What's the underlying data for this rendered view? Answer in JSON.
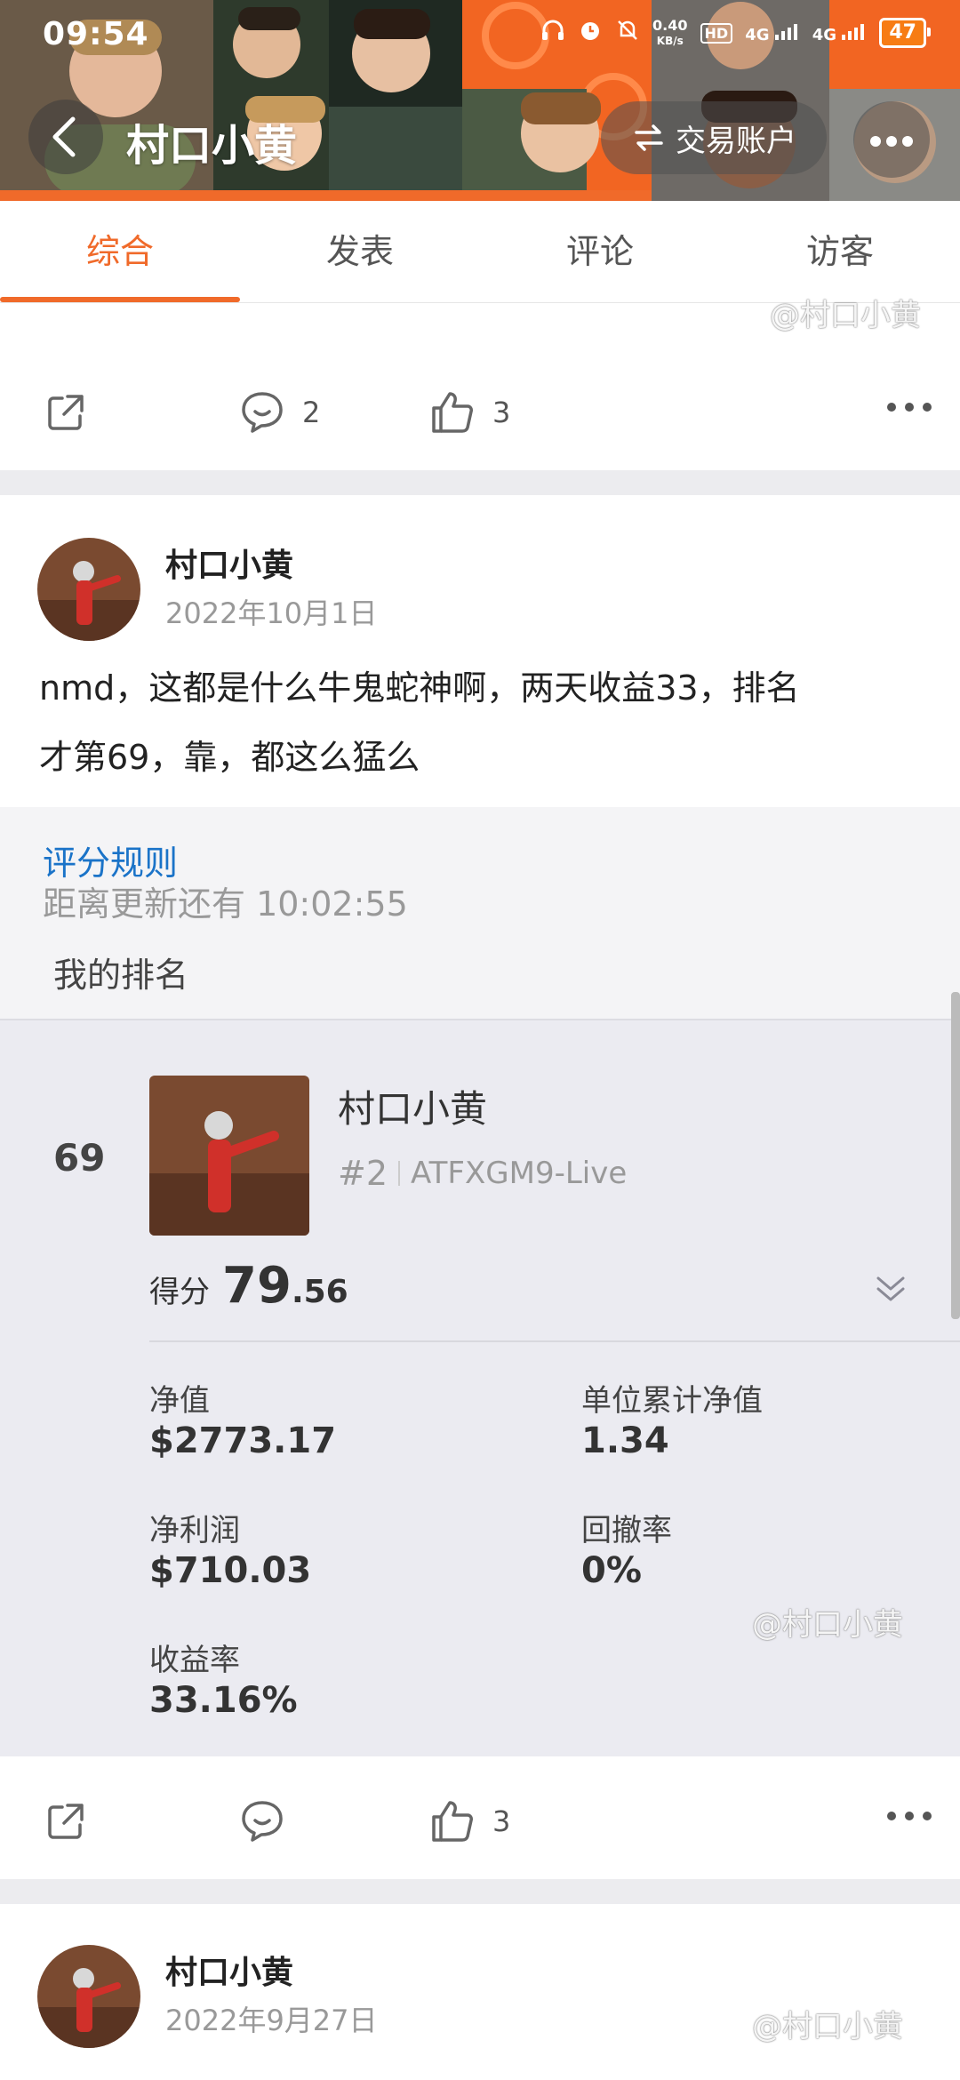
{
  "status_bar": {
    "time": "09:54",
    "net_speed_value": "0.40",
    "net_speed_unit": "KB/s",
    "hd_label": "HD",
    "sim1": "4G",
    "sim2": "4G",
    "battery": "47"
  },
  "header": {
    "title": "村口小黄",
    "account_button": "交易账户"
  },
  "tabs": [
    {
      "label": "综合",
      "active": true
    },
    {
      "label": "发表",
      "active": false
    },
    {
      "label": "评论",
      "active": false
    },
    {
      "label": "访客",
      "active": false
    }
  ],
  "watermark": "@村口小黄",
  "post_prev": {
    "comments": "2",
    "likes": "3"
  },
  "post_main": {
    "author": "村口小黄",
    "date": "2022年10月1日",
    "text_line1": "nmd，这都是什么牛鬼蛇神啊，两天收益33，排名",
    "text_line2": "才第69，靠，都这么猛么",
    "ranking": {
      "rule_link": "评分规则",
      "countdown": "距离更新还有 10:02:55",
      "my_rank_label": "我的排名",
      "rank": "69",
      "name": "村口小黄",
      "account_num": "#2",
      "account_name": "ATFXGM9-Live",
      "score_label": "得分",
      "score_int": "79",
      "score_dec": ".56",
      "stats": {
        "net_value_label": "净值",
        "net_value": "$2773.17",
        "unit_nav_label": "单位累计净值",
        "unit_nav": "1.34",
        "net_profit_label": "净利润",
        "net_profit": "$710.03",
        "drawdown_label": "回撤率",
        "drawdown": "0%",
        "return_label": "收益率",
        "return": "33.16%"
      }
    },
    "likes": "3"
  },
  "post_next": {
    "author": "村口小黄",
    "date": "2022年9月27日"
  }
}
